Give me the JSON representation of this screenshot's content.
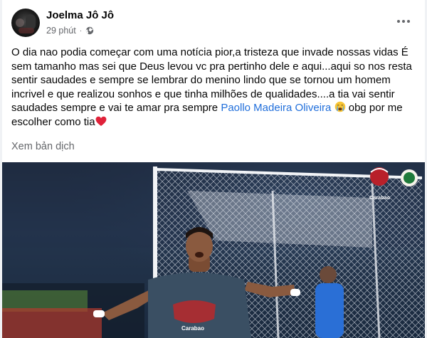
{
  "post": {
    "author": "Joelma Jô Jô",
    "time": "29 phút",
    "separator": "·",
    "privacy_icon": "globe-icon",
    "more_icon": "more-options-icon",
    "text_main": "O dia nao podia começar com uma notícia pior,a tristeza que invade nossas vidas É sem tamanho mas sei que Deus levou vc pra pertinho dele e aqui...aqui so nos resta sentir saudades e sempre se lembrar do menino lindo que se tornou um homem incrivel e que realizou sonhos e que tinha milhões de qualidades....a tia vai sentir saudades sempre e vai te amar pra sempre ",
    "mention": "Paollo Madeira Oliveira",
    "text_after_mention": " obg por me escolher como tia",
    "emoji_1": "crying-face-emoji",
    "emoji_2": "red-heart-emoji",
    "translate_label": "Xem bản dịch"
  },
  "photo": {
    "description_icon": "football-celebration-photo",
    "sponsor_logo_text": "Carabao",
    "jersey_sponsor_text": "Carabao",
    "colors": {
      "jersey": "#3a4f63",
      "goal_net": "#e6e9ee",
      "opponent_kit": "#2a6fd6"
    }
  },
  "colors": {
    "link": "#216fdb",
    "secondary_text": "#65676b",
    "primary_text": "#050505"
  }
}
